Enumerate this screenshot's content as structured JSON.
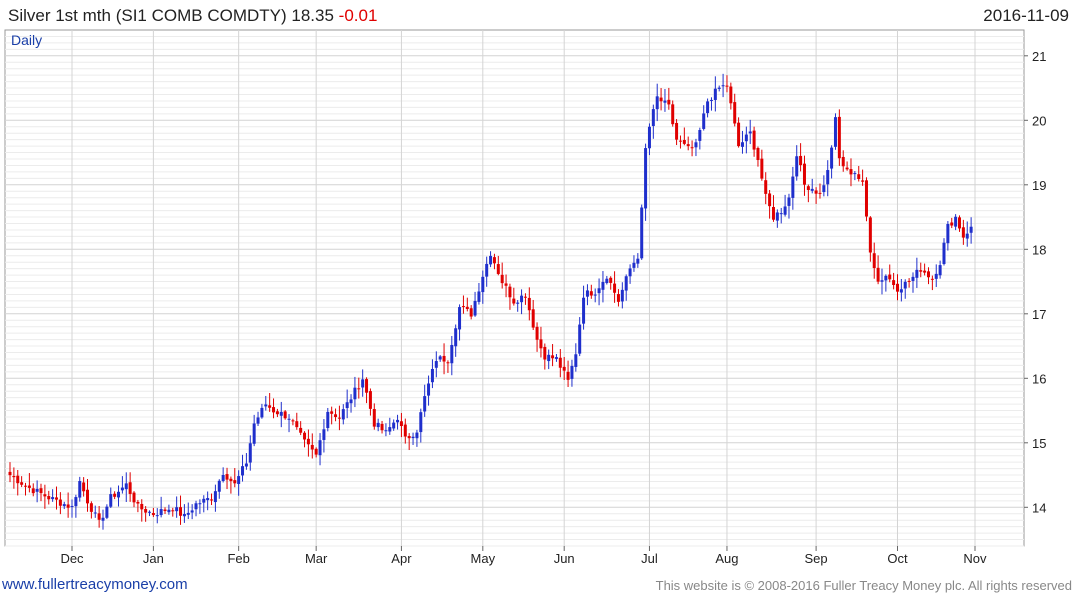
{
  "header": {
    "title": "Silver 1st mth (SI1 COMB COMDTY)",
    "last_price": "18.35",
    "change": "-0.01",
    "date": "2016-11-09"
  },
  "period_label": "Daily",
  "footer": {
    "link": "www.fullertreacymoney.com",
    "copyright": "This website is © 2008-2016 Fuller Treacy Money plc. All rights reserved"
  },
  "colors": {
    "up": "#1f2fcc",
    "down": "#e00000",
    "grid": "#d4d4d4",
    "text": "#222222"
  },
  "chart_data": {
    "type": "candlestick",
    "title": "Silver 1st mth (SI1 COMB COMDTY)",
    "frequency": "Daily",
    "y_axis": {
      "side": "right",
      "min": 13.4,
      "max": 21.4,
      "ticks": [
        14,
        15,
        16,
        17,
        18,
        19,
        20,
        21
      ]
    },
    "x_axis": {
      "ticks": [
        {
          "label": "Dec",
          "day": 16
        },
        {
          "label": "Jan",
          "day": 37
        },
        {
          "label": "Feb",
          "day": 59
        },
        {
          "label": "Mar",
          "day": 79
        },
        {
          "label": "Apr",
          "day": 101
        },
        {
          "label": "May",
          "day": 122
        },
        {
          "label": "Jun",
          "day": 143
        },
        {
          "label": "Jul",
          "day": 165
        },
        {
          "label": "Aug",
          "day": 185
        },
        {
          "label": "Sep",
          "day": 208
        },
        {
          "label": "Oct",
          "day": 229
        },
        {
          "label": "Nov",
          "day": 249
        }
      ],
      "range_days": [
        0,
        257
      ]
    },
    "grid": true,
    "last": 18.35,
    "change": -0.01,
    "anchors": [
      [
        0,
        14.5
      ],
      [
        5,
        14.3
      ],
      [
        10,
        14.15
      ],
      [
        16,
        14.0
      ],
      [
        18,
        14.4
      ],
      [
        20,
        14.1
      ],
      [
        23,
        13.75
      ],
      [
        26,
        14.15
      ],
      [
        30,
        14.35
      ],
      [
        33,
        14.0
      ],
      [
        37,
        13.9
      ],
      [
        42,
        14.0
      ],
      [
        45,
        13.85
      ],
      [
        48,
        14.05
      ],
      [
        52,
        14.15
      ],
      [
        55,
        14.55
      ],
      [
        58,
        14.35
      ],
      [
        61,
        14.7
      ],
      [
        63,
        15.3
      ],
      [
        66,
        15.6
      ],
      [
        68,
        15.5
      ],
      [
        72,
        15.4
      ],
      [
        76,
        15.0
      ],
      [
        79,
        14.8
      ],
      [
        82,
        15.5
      ],
      [
        85,
        15.4
      ],
      [
        88,
        15.7
      ],
      [
        91,
        16.0
      ],
      [
        94,
        15.3
      ],
      [
        97,
        15.15
      ],
      [
        100,
        15.4
      ],
      [
        102,
        15.05
      ],
      [
        105,
        15.2
      ],
      [
        107,
        15.7
      ],
      [
        110,
        16.3
      ],
      [
        113,
        16.3
      ],
      [
        116,
        17.1
      ],
      [
        119,
        17.0
      ],
      [
        122,
        17.6
      ],
      [
        124,
        17.95
      ],
      [
        127,
        17.5
      ],
      [
        130,
        17.2
      ],
      [
        133,
        17.3
      ],
      [
        136,
        16.6
      ],
      [
        138,
        16.35
      ],
      [
        141,
        16.3
      ],
      [
        144,
        15.95
      ],
      [
        146,
        16.4
      ],
      [
        148,
        17.3
      ],
      [
        151,
        17.35
      ],
      [
        154,
        17.6
      ],
      [
        157,
        17.2
      ],
      [
        160,
        17.7
      ],
      [
        162,
        17.9
      ],
      [
        163,
        18.6
      ],
      [
        164,
        19.55
      ],
      [
        165,
        19.9
      ],
      [
        167,
        20.35
      ],
      [
        170,
        20.2
      ],
      [
        172,
        19.7
      ],
      [
        175,
        19.55
      ],
      [
        177,
        19.6
      ],
      [
        180,
        20.3
      ],
      [
        183,
        20.5
      ],
      [
        185,
        20.55
      ],
      [
        188,
        19.6
      ],
      [
        191,
        19.8
      ],
      [
        193,
        19.4
      ],
      [
        195,
        18.8
      ],
      [
        197,
        18.5
      ],
      [
        199,
        18.6
      ],
      [
        201,
        18.8
      ],
      [
        203,
        19.5
      ],
      [
        205,
        19.0
      ],
      [
        207,
        18.95
      ],
      [
        209,
        18.85
      ],
      [
        211,
        19.2
      ],
      [
        213,
        20.0
      ],
      [
        214,
        19.4
      ],
      [
        216,
        19.2
      ],
      [
        218,
        19.2
      ],
      [
        220,
        19.0
      ],
      [
        222,
        18.0
      ],
      [
        224,
        17.5
      ],
      [
        226,
        17.6
      ],
      [
        229,
        17.4
      ],
      [
        232,
        17.5
      ],
      [
        235,
        17.7
      ],
      [
        238,
        17.55
      ],
      [
        240,
        17.8
      ],
      [
        242,
        18.35
      ],
      [
        244,
        18.5
      ],
      [
        246,
        18.2
      ],
      [
        248,
        18.35
      ]
    ]
  }
}
